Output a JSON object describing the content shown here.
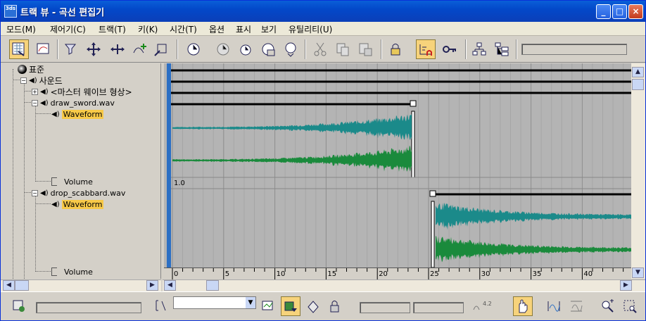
{
  "window": {
    "title": "트랙 뷰 - 곡선 편집기",
    "app_icon_text": "3ds",
    "controls": {
      "minimize": "_",
      "maximize": "□",
      "close": "×"
    }
  },
  "menu": [
    "모드(M)",
    "제어기(C)",
    "트랙(T)",
    "키(K)",
    "시간(T)",
    "옵션",
    "표시",
    "보기",
    "유틸리티(U)"
  ],
  "toolbar_icons": [
    "filter-icon",
    "curve-editor-icon",
    "select-icon",
    "move-keys-icon",
    "slide-keys-icon",
    "add-keys-icon",
    "scale-keys-icon",
    "select-time-icon",
    "delete-time-icon",
    "scale-time-icon",
    "insert-time-icon",
    "reverse-time-icon",
    "cut-icon",
    "copy-icon",
    "paste-icon",
    "lock-selection-icon",
    "snap-frames-icon",
    "show-keyable-icon",
    "show-hierarchy-icon",
    "modify-subtree-icon"
  ],
  "tree": {
    "root_label": "표준",
    "sound_label": "사운드",
    "master_label": "<마스터 웨이브 형상>",
    "file1": "draw_sword.wav",
    "waveform1": "Waveform",
    "volume1": "Volume",
    "file2": "drop_scabbard.wav",
    "waveform2": "Waveform",
    "volume2": "Volume"
  },
  "graph": {
    "volume_value": "1.0",
    "ruler_ticks": [
      "0",
      "5",
      "10",
      "15",
      "20",
      "25",
      "30",
      "35",
      "40"
    ],
    "colors": {
      "wave_top": "#1b8a8a",
      "wave_bottom": "#1a8a3c",
      "background": "#b4b4b4",
      "time_bar": "#2c6fc4"
    }
  },
  "statusbar": {
    "field1": "",
    "combo_value": "",
    "zoom_readout": "4.2",
    "icons": [
      "zoom-selected-icon",
      "track-view-name-icon",
      "key-stats-icon",
      "filter-tracks-icon",
      "show-selected-icon",
      "pan-icon",
      "zoom-horizontal-icon",
      "zoom-region-icon"
    ]
  }
}
